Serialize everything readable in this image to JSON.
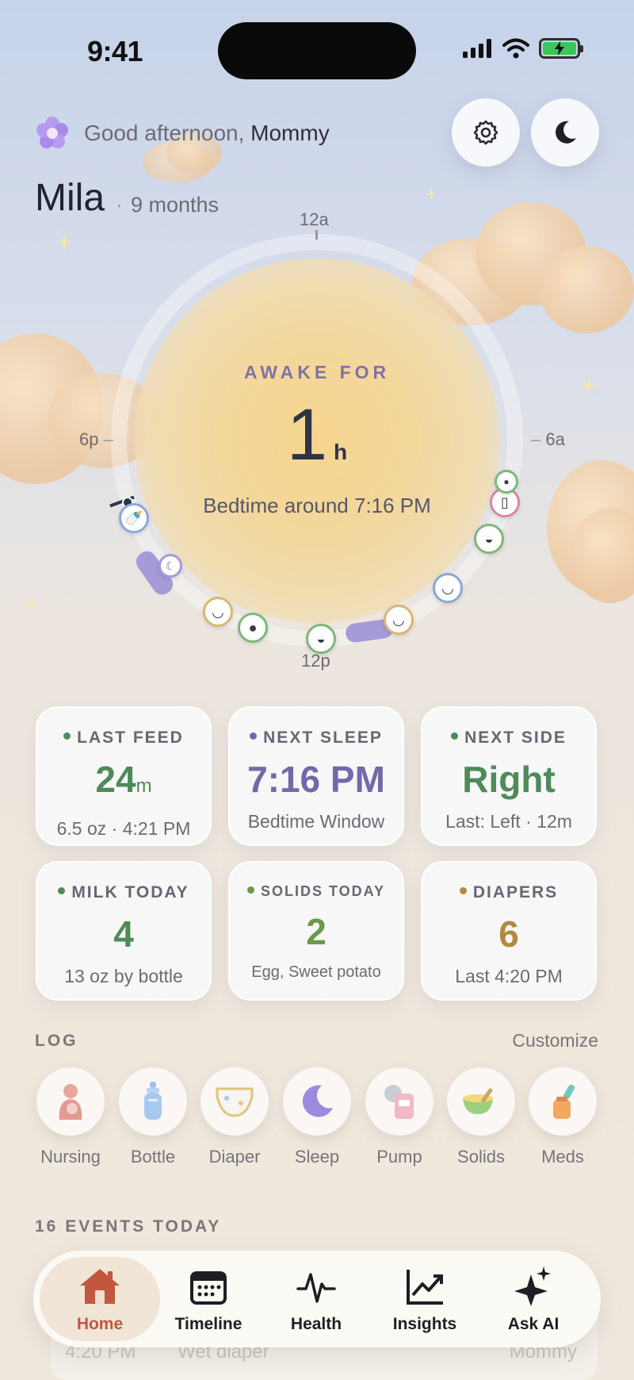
{
  "status_bar": {
    "time": "9:41",
    "icons": [
      "signal-icon",
      "wifi-icon",
      "battery-charging-icon"
    ]
  },
  "header": {
    "greeting": "Good afternoon,",
    "greeting_name": "Mommy",
    "baby_name": "Mila",
    "separator": "·",
    "age": "9 months",
    "buttons": [
      "gear-icon",
      "moon-icon"
    ]
  },
  "dial": {
    "labels": {
      "top": "12a",
      "right": "6a",
      "bottom": "12p",
      "left": "6p"
    },
    "status_label": "AWAKE FOR",
    "value": "1",
    "unit": "h",
    "bedtime": "Bedtime around 7:16 PM"
  },
  "stats": [
    {
      "title": "LAST FEED",
      "value": "24",
      "unit": "m",
      "sub": "6.5 oz · 4:21 PM",
      "color": "#4f8a5a",
      "dot": "#4f8a5a"
    },
    {
      "title": "NEXT SLEEP",
      "value": "7:16 PM",
      "unit": "",
      "sub": "Bedtime Window",
      "color": "#7468a8",
      "dot": "#7468a8"
    },
    {
      "title": "NEXT SIDE",
      "value": "Right",
      "unit": "",
      "sub": "Last: Left · 12m",
      "color": "#4f8a5a",
      "dot": "#4f8a5a"
    },
    {
      "title": "MILK TODAY",
      "value": "4",
      "unit": "",
      "sub": "13 oz by bottle",
      "color": "#4f8a5a",
      "dot": "#4f8a5a"
    },
    {
      "title": "SOLIDS TODAY",
      "value": "2",
      "unit": "",
      "sub": "Egg, Sweet potato",
      "color": "#6a9a4a",
      "dot": "#6a9a4a"
    },
    {
      "title": "DIAPERS",
      "value": "6",
      "unit": "",
      "sub": "Last 4:20 PM",
      "color": "#b08a3e",
      "dot": "#b08a3e"
    }
  ],
  "log": {
    "title": "LOG",
    "customize": "Customize",
    "items": [
      {
        "label": "Nursing",
        "icon": "nursing-icon"
      },
      {
        "label": "Bottle",
        "icon": "bottle-icon"
      },
      {
        "label": "Diaper",
        "icon": "diaper-icon"
      },
      {
        "label": "Sleep",
        "icon": "sleep-icon"
      },
      {
        "label": "Pump",
        "icon": "pump-icon"
      },
      {
        "label": "Solids",
        "icon": "solids-icon"
      },
      {
        "label": "Meds",
        "icon": "meds-icon"
      }
    ]
  },
  "events": {
    "title": "16 EVENTS TODAY",
    "peek": {
      "time": "4:20 PM",
      "text": "Wet diaper",
      "by": "Mommy"
    }
  },
  "nav": [
    {
      "label": "Home",
      "icon": "home-icon",
      "active": true
    },
    {
      "label": "Timeline",
      "icon": "calendar-icon",
      "active": false
    },
    {
      "label": "Health",
      "icon": "heartbeat-icon",
      "active": false
    },
    {
      "label": "Insights",
      "icon": "chart-icon",
      "active": false
    },
    {
      "label": "Ask AI",
      "icon": "sparkle-icon",
      "active": false
    }
  ],
  "colors": {
    "accent": "#c0583f",
    "lavender": "#7468a8",
    "green": "#4f8a5a"
  }
}
